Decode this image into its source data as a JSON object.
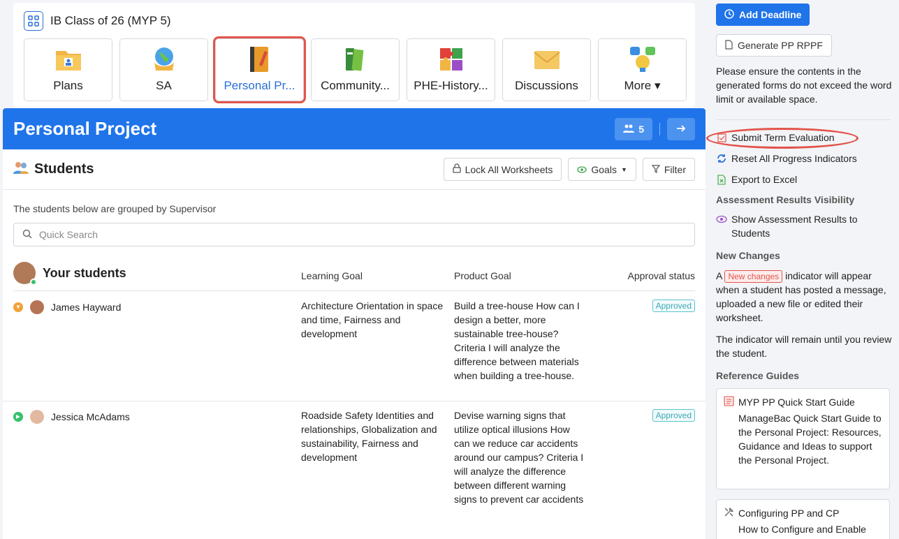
{
  "class_header": {
    "title": "IB Class of 26 (MYP 5)"
  },
  "tiles": [
    {
      "label": "Plans",
      "icon": "folder-icon"
    },
    {
      "label": "SA",
      "icon": "globe-icon"
    },
    {
      "label": "Personal Pr...",
      "icon": "notebook-icon"
    },
    {
      "label": "Community...",
      "icon": "books-icon"
    },
    {
      "label": "PHE-History...",
      "icon": "puzzle-icon"
    },
    {
      "label": "Discussions",
      "icon": "envelope-icon"
    },
    {
      "label": "More",
      "icon": "ideas-icon"
    }
  ],
  "hero": {
    "title": "Personal Project",
    "member_count": "5"
  },
  "students_section": {
    "title": "Students",
    "toolbar": {
      "lock": "Lock All Worksheets",
      "goals": "Goals",
      "filter": "Filter"
    },
    "grouped_note": "The students below are grouped by Supervisor",
    "search_placeholder": "Quick Search"
  },
  "table": {
    "group_title": "Your students",
    "columns": [
      "Learning Goal",
      "Product Goal",
      "Approval status"
    ],
    "rows": [
      {
        "name": "James Hayward",
        "learning_goal": "Architecture Orientation in space and time, Fairness and development",
        "product_goal": "Build a tree-house How can I design a better, more sustainable tree-house? Criteria I will analyze the difference between materials when building a tree-house.",
        "status": "Approved"
      },
      {
        "name": "Jessica McAdams",
        "learning_goal": "Roadside Safety Identities and relationships, Globalization and sustainability, Fairness and development",
        "product_goal": "Devise warning signs that utilize optical illusions How can we reduce car accidents around our campus? Criteria I will analyze the difference between different warning signs to prevent car accidents",
        "status": "Approved"
      }
    ]
  },
  "sidebar": {
    "add_deadline": "Add Deadline",
    "generate": "Generate PP RPPF",
    "note": "Please ensure the contents in the generated forms do not exceed the word limit or available space.",
    "actions": {
      "submit": "Submit Term Evaluation",
      "reset": "Reset All Progress Indicators",
      "export": "Export to Excel"
    },
    "visibility_heading": "Assessment Results Visibility",
    "visibility_action": "Show Assessment Results to Students",
    "new_changes_heading": "New Changes",
    "new_changes_prefix": "A",
    "new_changes_badge": "New changes",
    "new_changes_suffix": "indicator will appear when a student has posted a message, uploaded a new file or edited their worksheet.",
    "remain_note": "The indicator will remain until you review the student.",
    "guides_heading": "Reference Guides",
    "guides": [
      {
        "title": "MYP PP Quick Start Guide",
        "desc": "ManageBac Quick Start Guide to the Personal Project: Resources, Guidance and Ideas to support the Personal Project."
      },
      {
        "title": "Configuring PP and CP",
        "desc": "How to Configure and Enable"
      }
    ]
  },
  "colors": {
    "primary": "#1f74ea",
    "highlight": "#e2544b",
    "approved": "#3aa9b6"
  }
}
